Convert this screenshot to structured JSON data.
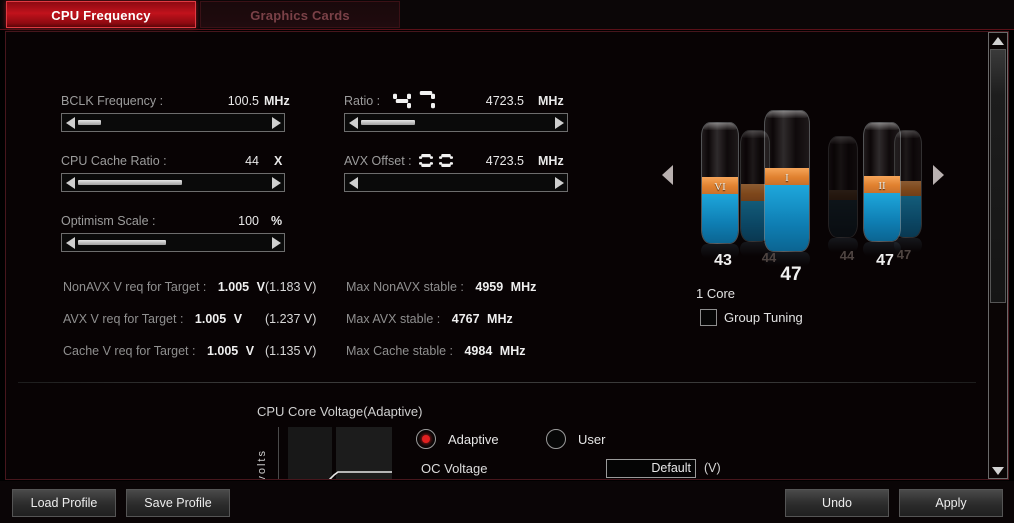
{
  "tabs": [
    {
      "label": "CPU Frequency",
      "active": true
    },
    {
      "label": "Graphics Cards",
      "active": false
    }
  ],
  "fields": {
    "bclk": {
      "label": "BCLK Frequency :",
      "value": "100.5",
      "unit": "MHz",
      "fill_pct": 12
    },
    "cache": {
      "label": "CPU Cache Ratio :",
      "value": "44",
      "unit": "X",
      "fill_pct": 54
    },
    "optimism": {
      "label": "Optimism Scale :",
      "value": "100",
      "unit": "%",
      "fill_pct": 46
    },
    "ratio": {
      "label": "Ratio :",
      "digits": "47",
      "value": "4723.5",
      "unit": "MHz",
      "fill_pct": 28
    },
    "avx": {
      "label": "AVX Offset :",
      "digits": "00",
      "value": "4723.5",
      "unit": "MHz",
      "fill_pct": 0
    }
  },
  "readouts": [
    {
      "label": "NonAVX V req for Target :",
      "value": "1.005",
      "unit": "V",
      "paren": "(1.183  V)",
      "right_label": "Max NonAVX stable :",
      "right_value": "4959",
      "right_unit": "MHz"
    },
    {
      "label": "AVX V req for Target :",
      "value": "1.005",
      "unit": "V",
      "paren": "(1.237  V)",
      "right_label": "Max AVX stable :",
      "right_value": "4767",
      "right_unit": "MHz"
    },
    {
      "label": "Cache V req for Target :",
      "value": "1.005",
      "unit": "V",
      "paren": "(1.135  V)",
      "right_label": "Max Cache stable :",
      "right_value": "4984",
      "right_unit": "MHz"
    }
  ],
  "carousel": {
    "prev_arrow": "left-arrow-icon",
    "next_arrow": "right-arrow-icon",
    "cores": [
      {
        "number": "43",
        "roman": "VI",
        "state": "active",
        "dim": false
      },
      {
        "number": "44",
        "roman": "",
        "state": "behind",
        "dim": true
      },
      {
        "number": "47",
        "roman": "I",
        "state": "center",
        "dim": false
      },
      {
        "number": "44",
        "roman": "",
        "state": "faded",
        "dim": true
      },
      {
        "number": "47",
        "roman": "II",
        "state": "active",
        "dim": false
      },
      {
        "number": "47",
        "roman": "",
        "state": "behind",
        "dim": true
      }
    ],
    "core_count": "1 Core",
    "group_tuning_label": "Group Tuning",
    "group_tuning_checked": false
  },
  "voltage": {
    "heading": "CPU Core Voltage(Adaptive)",
    "chart_ylabel": "volts",
    "modes": [
      {
        "label": "Adaptive",
        "selected": true
      },
      {
        "label": "User",
        "selected": false
      }
    ],
    "oc_voltage_label": "OC Voltage",
    "oc_voltage_value": "Default",
    "oc_voltage_unit": "(V)"
  },
  "scrollbar": {
    "up": "scroll-up-arrow-icon",
    "down": "scroll-down-arrow-icon"
  },
  "footer": {
    "load_profile": "Load Profile",
    "save_profile": "Save Profile",
    "undo": "Undo",
    "apply": "Apply"
  },
  "colors": {
    "accent_red": "#c1121c",
    "liquid_blue": "#1fa9de",
    "liquid_orange": "#e0812f",
    "panel_border": "#46161c"
  }
}
